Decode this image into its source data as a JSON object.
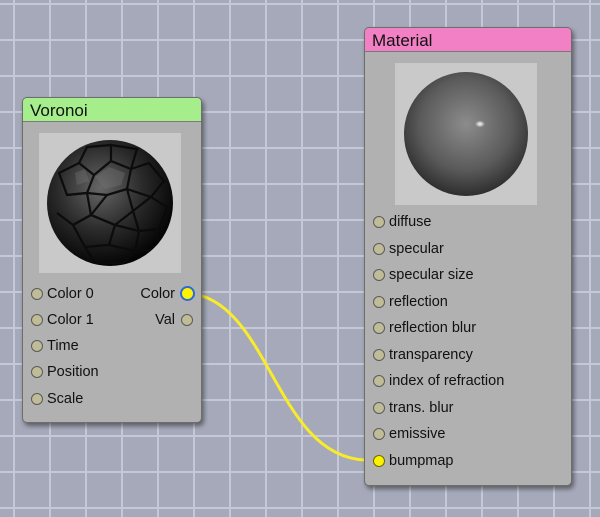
{
  "colors": {
    "voronoi_header": "#a6ee8c",
    "material_header": "#f280c4",
    "wire": "#f8ec2a",
    "port_idle": "#c0bc98",
    "port_active": "#fff200"
  },
  "voronoi": {
    "title": "Voronoi",
    "inputs": [
      "Color 0",
      "Color 1",
      "Time",
      "Position",
      "Scale"
    ],
    "outputs": [
      "Color",
      "Val"
    ]
  },
  "material": {
    "title": "Material",
    "inputs": [
      "diffuse",
      "specular",
      "specular size",
      "reflection",
      "reflection blur",
      "transparency",
      "index of refraction",
      "trans. blur",
      "emissive",
      "bumpmap"
    ]
  },
  "connection": {
    "from": "Voronoi.Color",
    "to": "Material.bumpmap"
  }
}
